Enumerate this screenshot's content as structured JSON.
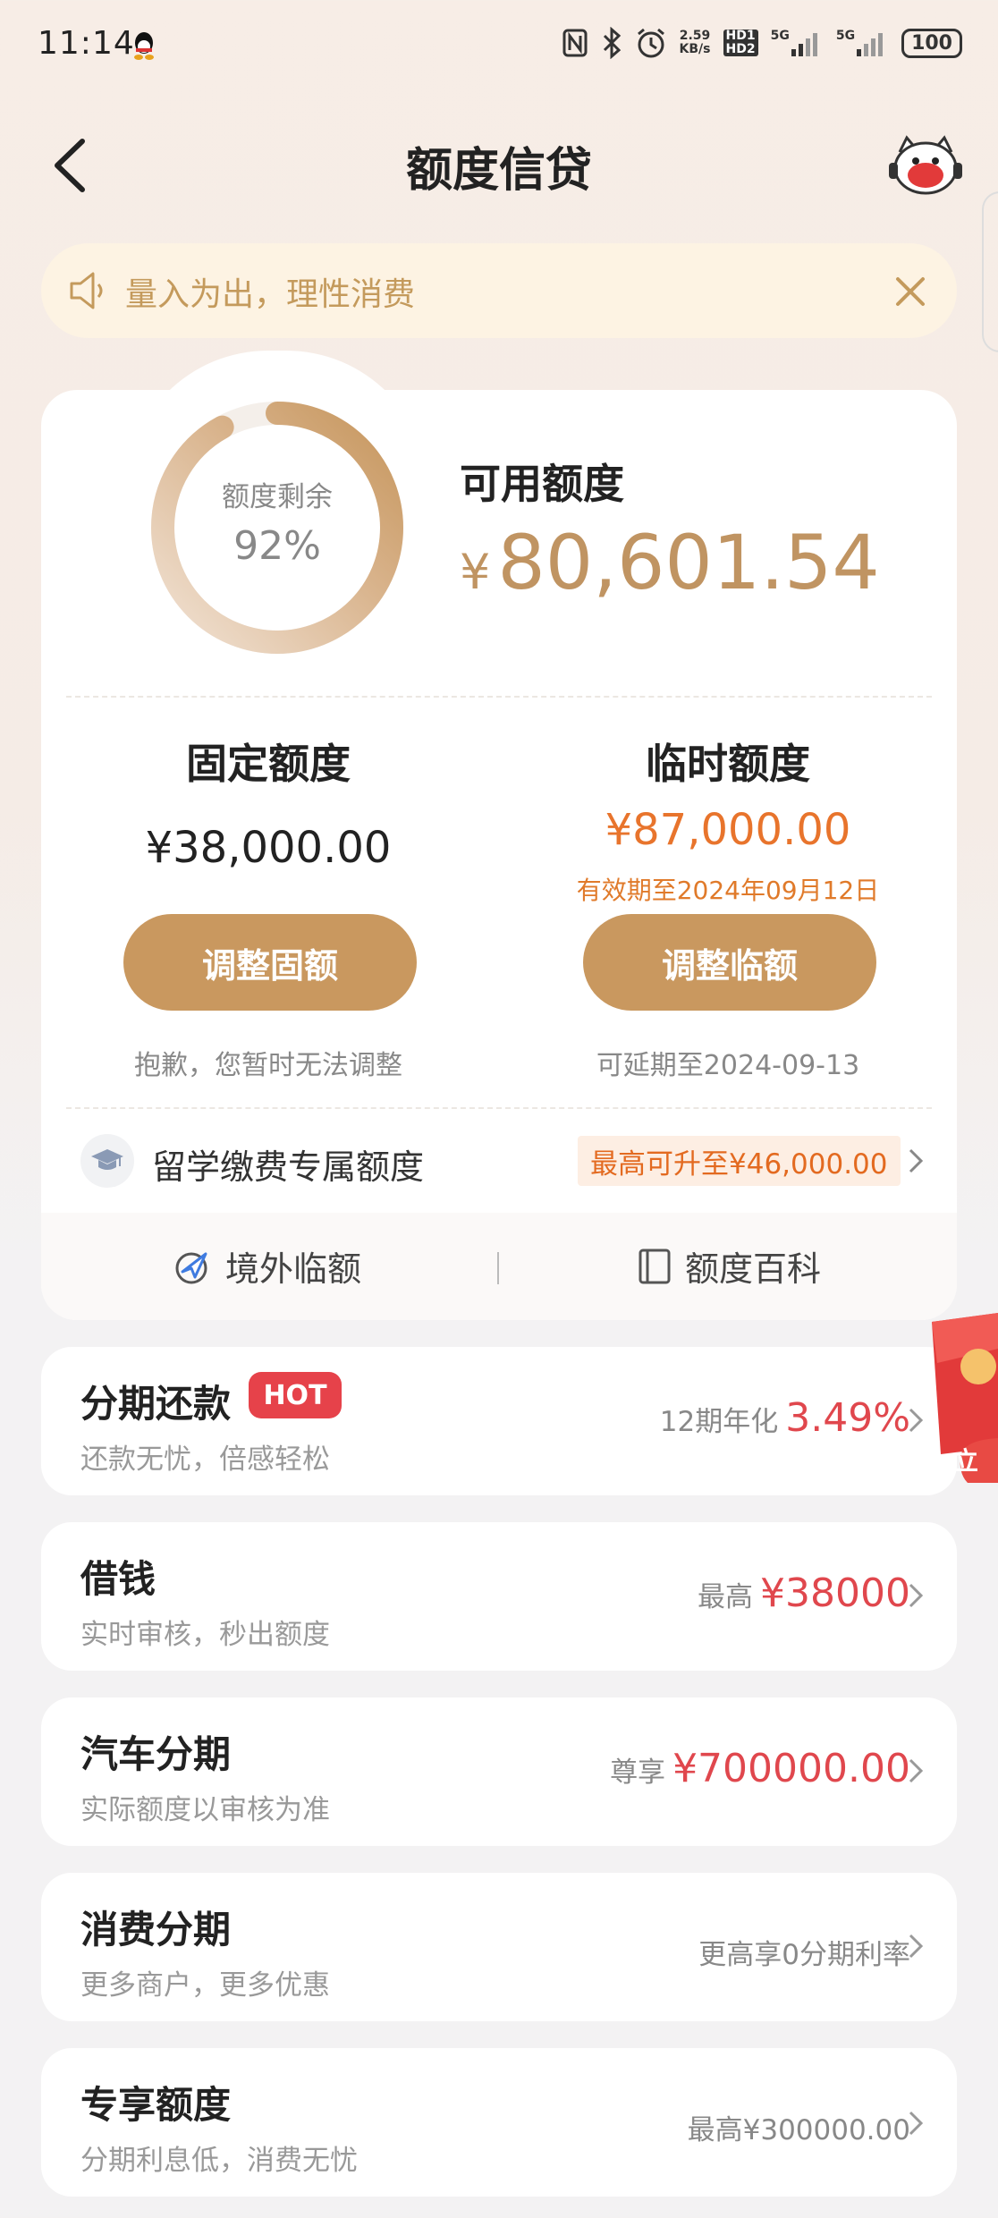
{
  "status_bar": {
    "time": "11:14",
    "net_speed_value": "2.59",
    "net_speed_unit": "KB/s",
    "hd_label_1": "HD1",
    "hd_label_2": "HD2",
    "signal_1": "5G",
    "signal_2": "5G",
    "battery": "100"
  },
  "header": {
    "title": "额度信贷"
  },
  "notice": {
    "text": "量入为出，理性消费"
  },
  "summary": {
    "ring_label": "额度剩余",
    "ring_percent": "92%",
    "ring_fraction": 0.92,
    "available_label": "可用额度",
    "currency": "¥",
    "available_amount": "80,601.54"
  },
  "fixed_limit": {
    "title": "固定额度",
    "value": "¥38,000.00",
    "button": "调整固额",
    "note": "抱歉，您暂时无法调整"
  },
  "temp_limit": {
    "title": "临时额度",
    "value": "¥87,000.00",
    "expiry": "有效期至2024年09月12日",
    "button": "调整临额",
    "note": "可延期至2024-09-13"
  },
  "study": {
    "label": "留学缴费专属额度",
    "badge": "最高可升至¥46,000.00"
  },
  "bottom_links": {
    "overseas": "境外临额",
    "encyclopedia": "额度百科"
  },
  "rows": [
    {
      "title": "分期还款",
      "badge": "HOT",
      "subtitle": "还款无忧，倍感轻松",
      "right_prefix": "12期年化",
      "right_value": "3.49%"
    },
    {
      "title": "借钱",
      "subtitle": "实时审核，秒出额度",
      "right_prefix": "最高",
      "right_value": "¥38000"
    },
    {
      "title": "汽车分期",
      "subtitle": "实际额度以审核为准",
      "right_prefix": "尊享",
      "right_value": "¥700000.00"
    },
    {
      "title": "消费分期",
      "subtitle": "更多商户，更多优惠",
      "right_prefix": "更高享0分期利率"
    },
    {
      "title": "专享额度",
      "subtitle": "分期利息低，消费无忧",
      "right_prefix": "最高¥300000.00"
    }
  ],
  "floating": {
    "red_packet_text": "立"
  },
  "colors": {
    "accent_gold": "#c9985f",
    "orange": "#e8742c",
    "red": "#e0474d"
  }
}
